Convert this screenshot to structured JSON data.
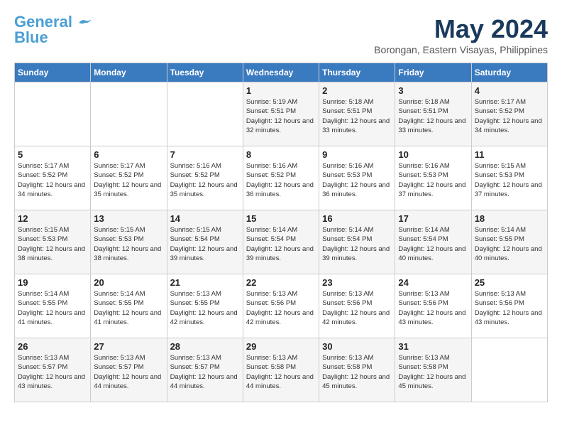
{
  "logo": {
    "line1": "General",
    "line2": "Blue"
  },
  "title": "May 2024",
  "location": "Borongan, Eastern Visayas, Philippines",
  "weekdays": [
    "Sunday",
    "Monday",
    "Tuesday",
    "Wednesday",
    "Thursday",
    "Friday",
    "Saturday"
  ],
  "weeks": [
    [
      {
        "day": "",
        "content": ""
      },
      {
        "day": "",
        "content": ""
      },
      {
        "day": "",
        "content": ""
      },
      {
        "day": "1",
        "content": "Sunrise: 5:19 AM\nSunset: 5:51 PM\nDaylight: 12 hours\nand 32 minutes."
      },
      {
        "day": "2",
        "content": "Sunrise: 5:18 AM\nSunset: 5:51 PM\nDaylight: 12 hours\nand 33 minutes."
      },
      {
        "day": "3",
        "content": "Sunrise: 5:18 AM\nSunset: 5:51 PM\nDaylight: 12 hours\nand 33 minutes."
      },
      {
        "day": "4",
        "content": "Sunrise: 5:17 AM\nSunset: 5:52 PM\nDaylight: 12 hours\nand 34 minutes."
      }
    ],
    [
      {
        "day": "5",
        "content": "Sunrise: 5:17 AM\nSunset: 5:52 PM\nDaylight: 12 hours\nand 34 minutes."
      },
      {
        "day": "6",
        "content": "Sunrise: 5:17 AM\nSunset: 5:52 PM\nDaylight: 12 hours\nand 35 minutes."
      },
      {
        "day": "7",
        "content": "Sunrise: 5:16 AM\nSunset: 5:52 PM\nDaylight: 12 hours\nand 35 minutes."
      },
      {
        "day": "8",
        "content": "Sunrise: 5:16 AM\nSunset: 5:52 PM\nDaylight: 12 hours\nand 36 minutes."
      },
      {
        "day": "9",
        "content": "Sunrise: 5:16 AM\nSunset: 5:53 PM\nDaylight: 12 hours\nand 36 minutes."
      },
      {
        "day": "10",
        "content": "Sunrise: 5:16 AM\nSunset: 5:53 PM\nDaylight: 12 hours\nand 37 minutes."
      },
      {
        "day": "11",
        "content": "Sunrise: 5:15 AM\nSunset: 5:53 PM\nDaylight: 12 hours\nand 37 minutes."
      }
    ],
    [
      {
        "day": "12",
        "content": "Sunrise: 5:15 AM\nSunset: 5:53 PM\nDaylight: 12 hours\nand 38 minutes."
      },
      {
        "day": "13",
        "content": "Sunrise: 5:15 AM\nSunset: 5:53 PM\nDaylight: 12 hours\nand 38 minutes."
      },
      {
        "day": "14",
        "content": "Sunrise: 5:15 AM\nSunset: 5:54 PM\nDaylight: 12 hours\nand 39 minutes."
      },
      {
        "day": "15",
        "content": "Sunrise: 5:14 AM\nSunset: 5:54 PM\nDaylight: 12 hours\nand 39 minutes."
      },
      {
        "day": "16",
        "content": "Sunrise: 5:14 AM\nSunset: 5:54 PM\nDaylight: 12 hours\nand 39 minutes."
      },
      {
        "day": "17",
        "content": "Sunrise: 5:14 AM\nSunset: 5:54 PM\nDaylight: 12 hours\nand 40 minutes."
      },
      {
        "day": "18",
        "content": "Sunrise: 5:14 AM\nSunset: 5:55 PM\nDaylight: 12 hours\nand 40 minutes."
      }
    ],
    [
      {
        "day": "19",
        "content": "Sunrise: 5:14 AM\nSunset: 5:55 PM\nDaylight: 12 hours\nand 41 minutes."
      },
      {
        "day": "20",
        "content": "Sunrise: 5:14 AM\nSunset: 5:55 PM\nDaylight: 12 hours\nand 41 minutes."
      },
      {
        "day": "21",
        "content": "Sunrise: 5:13 AM\nSunset: 5:55 PM\nDaylight: 12 hours\nand 42 minutes."
      },
      {
        "day": "22",
        "content": "Sunrise: 5:13 AM\nSunset: 5:56 PM\nDaylight: 12 hours\nand 42 minutes."
      },
      {
        "day": "23",
        "content": "Sunrise: 5:13 AM\nSunset: 5:56 PM\nDaylight: 12 hours\nand 42 minutes."
      },
      {
        "day": "24",
        "content": "Sunrise: 5:13 AM\nSunset: 5:56 PM\nDaylight: 12 hours\nand 43 minutes."
      },
      {
        "day": "25",
        "content": "Sunrise: 5:13 AM\nSunset: 5:56 PM\nDaylight: 12 hours\nand 43 minutes."
      }
    ],
    [
      {
        "day": "26",
        "content": "Sunrise: 5:13 AM\nSunset: 5:57 PM\nDaylight: 12 hours\nand 43 minutes."
      },
      {
        "day": "27",
        "content": "Sunrise: 5:13 AM\nSunset: 5:57 PM\nDaylight: 12 hours\nand 44 minutes."
      },
      {
        "day": "28",
        "content": "Sunrise: 5:13 AM\nSunset: 5:57 PM\nDaylight: 12 hours\nand 44 minutes."
      },
      {
        "day": "29",
        "content": "Sunrise: 5:13 AM\nSunset: 5:58 PM\nDaylight: 12 hours\nand 44 minutes."
      },
      {
        "day": "30",
        "content": "Sunrise: 5:13 AM\nSunset: 5:58 PM\nDaylight: 12 hours\nand 45 minutes."
      },
      {
        "day": "31",
        "content": "Sunrise: 5:13 AM\nSunset: 5:58 PM\nDaylight: 12 hours\nand 45 minutes."
      },
      {
        "day": "",
        "content": ""
      }
    ]
  ]
}
